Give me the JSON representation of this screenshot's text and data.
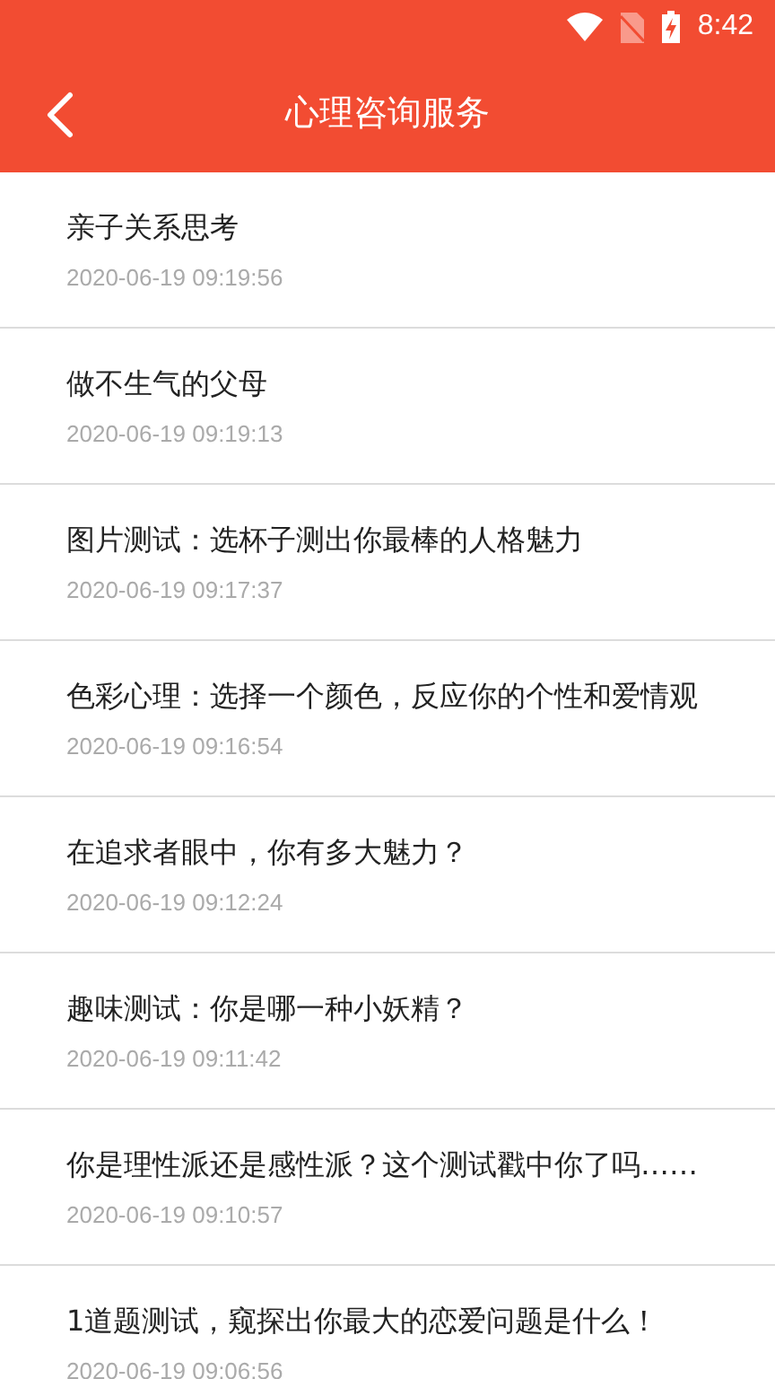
{
  "status_bar": {
    "time": "8:42"
  },
  "app_bar": {
    "title": "心理咨询服务"
  },
  "items": [
    {
      "title": "亲子关系思考",
      "date": "2020-06-19 09:19:56"
    },
    {
      "title": "做不生气的父母",
      "date": "2020-06-19 09:19:13"
    },
    {
      "title": "图片测试：选杯子测出你最棒的人格魅力",
      "date": "2020-06-19 09:17:37"
    },
    {
      "title": "色彩心理：选择一个颜色，反应你的个性和爱情观",
      "date": "2020-06-19 09:16:54"
    },
    {
      "title": "在追求者眼中，你有多大魅力？",
      "date": "2020-06-19 09:12:24"
    },
    {
      "title": "趣味测试：你是哪一种小妖精？",
      "date": "2020-06-19 09:11:42"
    },
    {
      "title": "你是理性派还是感性派？这个测试戳中你了吗……",
      "date": "2020-06-19 09:10:57"
    },
    {
      "title": "1道题测试，窥探出你最大的恋爱问题是什么！",
      "date": "2020-06-19 09:06:56"
    }
  ]
}
